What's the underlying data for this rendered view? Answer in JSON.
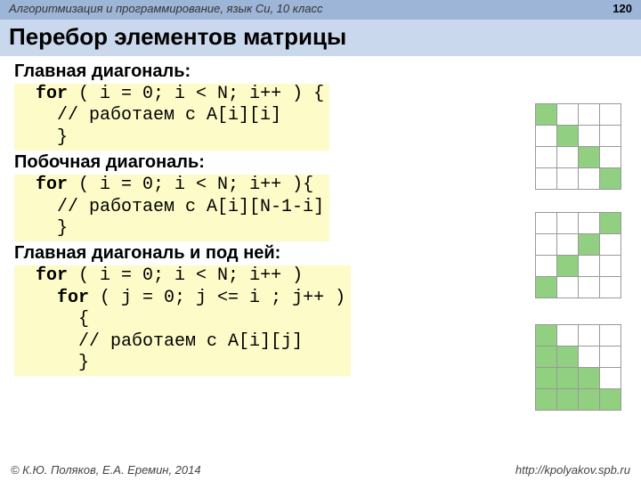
{
  "header": {
    "course": "Алгоритмизация и программирование, язык Си, 10 класс",
    "page_number": "120"
  },
  "title": "Перебор элементов матрицы",
  "sections": [
    {
      "heading": "Главная диагональ:",
      "code_lines": [
        {
          "indent": "  ",
          "pre_kw": "",
          "kw": "for",
          "rest": " ( i = 0; i < N; i++ ) {"
        },
        {
          "indent": "    ",
          "pre_kw": "// работаем с A[i][i]",
          "kw": "",
          "rest": ""
        },
        {
          "indent": "    ",
          "pre_kw": "}",
          "kw": "",
          "rest": ""
        }
      ],
      "grid_top": "116",
      "grid": [
        [
          1,
          0,
          0,
          0
        ],
        [
          0,
          1,
          0,
          0
        ],
        [
          0,
          0,
          1,
          0
        ],
        [
          0,
          0,
          0,
          1
        ]
      ]
    },
    {
      "heading": "Побочная диагональ:",
      "code_lines": [
        {
          "indent": "  ",
          "pre_kw": "",
          "kw": "for",
          "rest": " ( i = 0; i < N; i++ ){"
        },
        {
          "indent": "    ",
          "pre_kw": "// работаем с A[i][N-1-i]",
          "kw": "",
          "rest": ""
        },
        {
          "indent": "    ",
          "pre_kw": "}",
          "kw": "",
          "rest": ""
        }
      ],
      "grid_top": "238",
      "grid": [
        [
          0,
          0,
          0,
          1
        ],
        [
          0,
          0,
          1,
          0
        ],
        [
          0,
          1,
          0,
          0
        ],
        [
          1,
          0,
          0,
          0
        ]
      ]
    },
    {
      "heading": "Главная диагональ и под ней:",
      "code_lines": [
        {
          "indent": "  ",
          "pre_kw": "",
          "kw": "for",
          "rest": " ( i = 0; i < N; i++ )"
        },
        {
          "indent": "    ",
          "pre_kw": "",
          "kw": "for",
          "rest": " ( j = 0; j <= i ; j++ )"
        },
        {
          "indent": "      ",
          "pre_kw": "{",
          "kw": "",
          "rest": ""
        },
        {
          "indent": "      ",
          "pre_kw": "// работаем с A[i][j]",
          "kw": "",
          "rest": ""
        },
        {
          "indent": "      ",
          "pre_kw": "}",
          "kw": "",
          "rest": ""
        }
      ],
      "grid_top": "364",
      "grid": [
        [
          1,
          0,
          0,
          0
        ],
        [
          1,
          1,
          0,
          0
        ],
        [
          1,
          1,
          1,
          0
        ],
        [
          1,
          1,
          1,
          1
        ]
      ]
    }
  ],
  "footer": {
    "left": "© К.Ю. Поляков, Е.А. Еремин, 2014",
    "right": "http://kpolyakov.spb.ru"
  }
}
